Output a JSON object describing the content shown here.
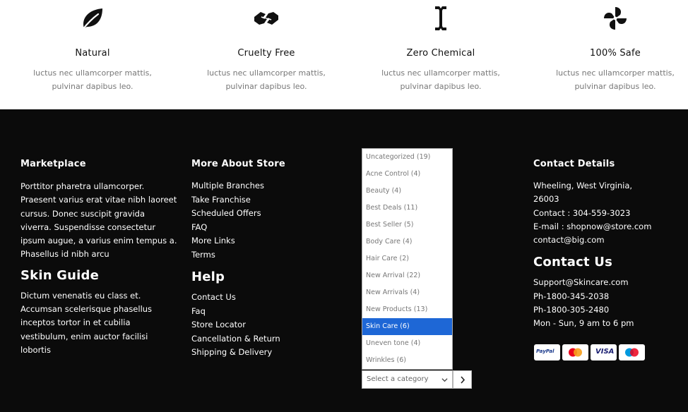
{
  "features": [
    {
      "icon": "leaf-icon",
      "title": "Natural",
      "desc_line1": "luctus nec ullamcorper mattis,",
      "desc_line2": "pulvinar dapibus leo."
    },
    {
      "icon": "hands-icon",
      "title": "Cruelty Free",
      "desc_line1": "luctus nec ullamcorper mattis,",
      "desc_line2": "pulvinar dapibus leo."
    },
    {
      "icon": "cursor-icon",
      "title": "Zero Chemical",
      "desc_line1": "luctus nec ullamcorper mattis,",
      "desc_line2": "pulvinar dapibus leo."
    },
    {
      "icon": "pinwheel-icon",
      "title": "100% Safe",
      "desc_line1": "luctus nec ullamcorper mattis,",
      "desc_line2": "pulvinar dapibus leo."
    }
  ],
  "marketplace": {
    "heading": "Marketplace",
    "text": "Porttitor pharetra ullamcorper. Praesent varius erat vitae nibh laoreet cursus. Donec suscipit gravida viverra. Suspendisse consectetur ipsum augue, a varius enim tempus a. Phasellus id nibh arcu"
  },
  "skin_guide": {
    "heading": "Skin Guide",
    "text": "Dictum venenatis eu class et. Accumsan scelerisque phasellus inceptos tortor in et cubilia vestibulum, enim auctor facilisi lobortis"
  },
  "more_about": {
    "heading": "More About Store",
    "links": [
      "Multiple Branches",
      "Take Franchise",
      "Scheduled Offers",
      "FAQ",
      "More Links",
      "Terms"
    ]
  },
  "help": {
    "heading": "Help",
    "links": [
      "Contact Us",
      "Faq",
      "Store Locator",
      "Cancellation & Return",
      "Shipping & Delivery"
    ]
  },
  "category_dropdown": {
    "options": [
      "Uncategorized (19)",
      "Acne Control (4)",
      "Beauty (4)",
      "Best Deals (11)",
      "Best Seller (5)",
      "Body Care (4)",
      "Hair Care (2)",
      "New Arrival (22)",
      "New Arrivals (4)",
      "New Products (13)",
      "Skin Care (6)",
      "Uneven tone (4)",
      "Wrinkles (6)"
    ],
    "highlighted": "Skin Care (6)",
    "selected_label": "Select a category"
  },
  "contact_details": {
    "heading": "Contact Details",
    "lines": [
      "Wheeling, West Virginia,",
      "26003",
      "Contact : 304-559-3023",
      "E-mail : shopnow@store.com",
      "contact@big.com"
    ]
  },
  "contact_us": {
    "heading": "Contact Us",
    "lines": [
      "Support@Skincare.com",
      "Ph-1800-345-2038",
      "Ph-1800-305-2480",
      "Mon - Sun, 9 am to 6 pm"
    ]
  },
  "payment_cards": [
    {
      "name": "paypal-card-icon",
      "label": "PayPal"
    },
    {
      "name": "mastercard-card-icon",
      "label": ""
    },
    {
      "name": "visa-card-icon",
      "label": "VISA"
    },
    {
      "name": "maestro-card-icon",
      "label": ""
    }
  ],
  "colors": {
    "footer_bg": "#0b0b0b",
    "highlight": "#1e67d6",
    "muted": "#777777"
  }
}
